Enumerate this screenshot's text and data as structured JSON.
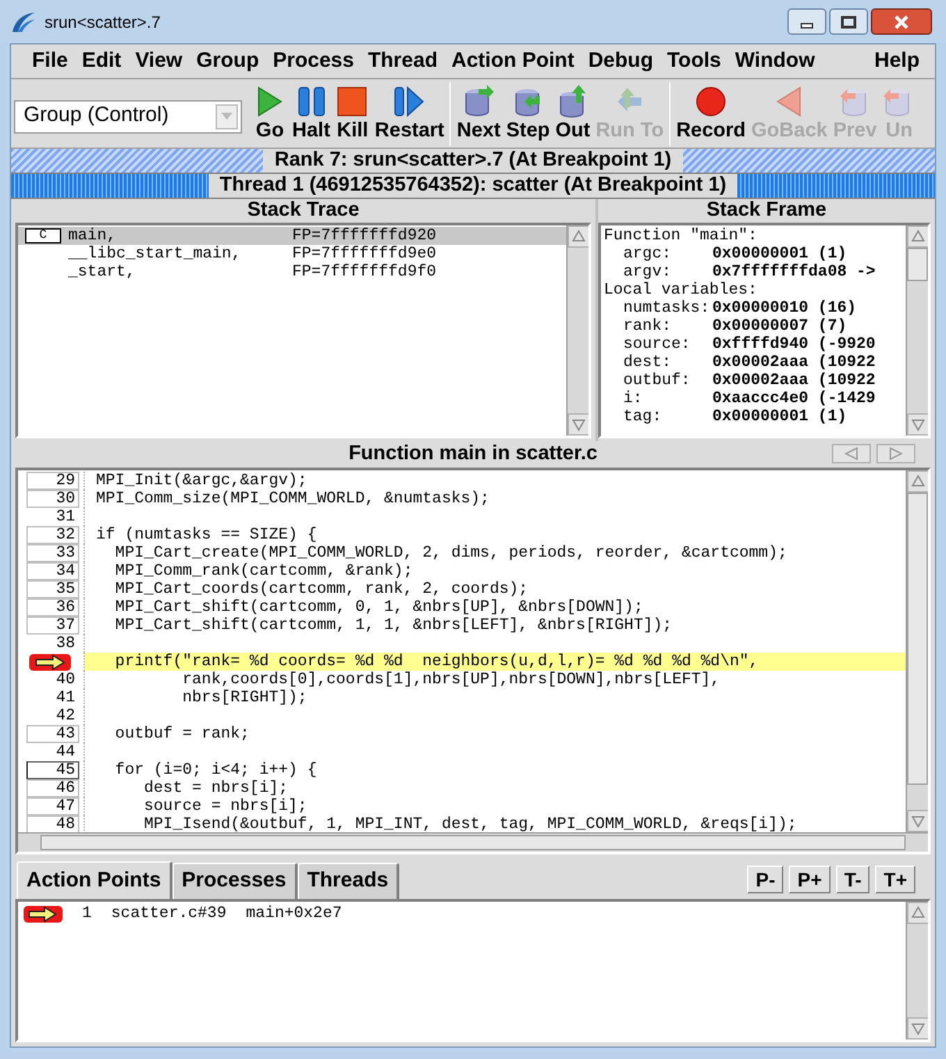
{
  "window": {
    "title": "srun<scatter>.7"
  },
  "menu": [
    {
      "label": "File"
    },
    {
      "label": "Edit"
    },
    {
      "label": "View"
    },
    {
      "label": "Group"
    },
    {
      "label": "Process"
    },
    {
      "label": "Thread"
    },
    {
      "label": "Action Point"
    },
    {
      "label": "Debug"
    },
    {
      "label": "Tools"
    },
    {
      "label": "Window"
    },
    {
      "label": "Help"
    }
  ],
  "toolbar": {
    "group_selector": "Group (Control)",
    "buttons": [
      {
        "kind": "go",
        "label": "Go",
        "disabled": false
      },
      {
        "kind": "halt",
        "label": "Halt",
        "disabled": false
      },
      {
        "kind": "kill",
        "label": "Kill",
        "disabled": false
      },
      {
        "kind": "restart",
        "label": "Restart",
        "disabled": false
      },
      {
        "kind": "next",
        "label": "Next",
        "disabled": false
      },
      {
        "kind": "step",
        "label": "Step",
        "disabled": false
      },
      {
        "kind": "out",
        "label": "Out",
        "disabled": false
      },
      {
        "kind": "runto",
        "label": "Run To",
        "disabled": true
      },
      {
        "kind": "record",
        "label": "Record",
        "disabled": false
      },
      {
        "kind": "goback",
        "label": "GoBack",
        "disabled": true
      },
      {
        "kind": "prev",
        "label": "Prev",
        "disabled": true
      },
      {
        "kind": "prev",
        "label": "Un",
        "disabled": true
      }
    ]
  },
  "rank_bar": "Rank 7: srun<scatter>.7 (At Breakpoint 1)",
  "thread_bar": "Thread 1 (46912535764352): scatter (At Breakpoint 1)",
  "stack_trace": {
    "title": "Stack Trace",
    "frames": [
      {
        "lang": "C",
        "name": "main,",
        "fp": "FP=7fffffffd920",
        "selected": true
      },
      {
        "name": "__libc_start_main,",
        "fp": "FP=7fffffffd9e0",
        "selected": false
      },
      {
        "name": "_start,",
        "fp": "FP=7fffffffd9f0",
        "selected": false
      }
    ]
  },
  "stack_frame": {
    "title": "Stack Frame",
    "rows": [
      {
        "kind": "heading",
        "text": "Function \"main\":"
      },
      {
        "kind": "var",
        "name": "argc:",
        "value": "0x00000001 (1)"
      },
      {
        "kind": "var",
        "name": "argv:",
        "value": "0x7fffffffda08 ->"
      },
      {
        "kind": "heading",
        "text": "Local variables:"
      },
      {
        "kind": "var",
        "name": "numtasks:",
        "value": "0x00000010 (16)"
      },
      {
        "kind": "var",
        "name": "rank:",
        "value": "0x00000007 (7)"
      },
      {
        "kind": "var",
        "name": "source:",
        "value": "0xffffd940 (-9920"
      },
      {
        "kind": "var",
        "name": "dest:",
        "value": "0x00002aaa (10922"
      },
      {
        "kind": "var",
        "name": "outbuf:",
        "value": "0x00002aaa (10922"
      },
      {
        "kind": "var",
        "name": "i:",
        "value": "0xaaccc4e0 (-1429"
      },
      {
        "kind": "var",
        "name": "tag:",
        "value": "0x00000001 (1)"
      }
    ]
  },
  "source": {
    "title": "Function main in scatter.c",
    "lines": [
      {
        "number": "29",
        "boxed": true,
        "text": "MPI_Init(&argc,&argv);"
      },
      {
        "number": "30",
        "boxed": true,
        "text": "MPI_Comm_size(MPI_COMM_WORLD, &numtasks);"
      },
      {
        "number": "31",
        "boxed": false
      },
      {
        "number": "32",
        "boxed": true,
        "text": "if (numtasks == SIZE) {"
      },
      {
        "number": "33",
        "boxed": true,
        "text": "  MPI_Cart_create(MPI_COMM_WORLD, 2, dims, periods, reorder, &cartcomm);"
      },
      {
        "number": "34",
        "boxed": true,
        "text": "  MPI_Comm_rank(cartcomm, &rank);"
      },
      {
        "number": "35",
        "boxed": true,
        "text": "  MPI_Cart_coords(cartcomm, rank, 2, coords);"
      },
      {
        "number": "36",
        "boxed": true,
        "text": "  MPI_Cart_shift(cartcomm, 0, 1, &nbrs[UP], &nbrs[DOWN]);"
      },
      {
        "number": "37",
        "boxed": true,
        "text": "  MPI_Cart_shift(cartcomm, 1, 1, &nbrs[LEFT], &nbrs[RIGHT]);"
      },
      {
        "number": "38",
        "boxed": false
      },
      {
        "action_point": true,
        "current": true,
        "text": "  printf(\"rank= %d coords= %d %d  neighbors(u,d,l,r)= %d %d %d %d\\n\","
      },
      {
        "number": "40",
        "boxed": false,
        "text": "         rank,coords[0],coords[1],nbrs[UP],nbrs[DOWN],nbrs[LEFT],"
      },
      {
        "number": "41",
        "boxed": false,
        "text": "         nbrs[RIGHT]);"
      },
      {
        "number": "42",
        "boxed": false
      },
      {
        "number": "43",
        "boxed": true,
        "text": "  outbuf = rank;"
      },
      {
        "number": "44",
        "boxed": false
      },
      {
        "number": "45",
        "boxed": true,
        "focused": true,
        "text": "  for (i=0; i<4; i++) {"
      },
      {
        "number": "46",
        "boxed": true,
        "text": "     dest = nbrs[i];"
      },
      {
        "number": "47",
        "boxed": true,
        "text": "     source = nbrs[i];"
      },
      {
        "number": "48",
        "boxed": true,
        "text": "     MPI_Isend(&outbuf, 1, MPI_INT, dest, tag, MPI_COMM_WORLD, &reqs[i]);"
      }
    ]
  },
  "bottom_tabs": [
    {
      "label": "Action Points",
      "selected": true
    },
    {
      "label": "Processes",
      "selected": false
    },
    {
      "label": "Threads",
      "selected": false
    }
  ],
  "bottom_buttons": [
    "P-",
    "P+",
    "T-",
    "T+"
  ],
  "action_points": [
    {
      "number": "1",
      "location": "scatter.c#39",
      "address": "main+0x2e7"
    }
  ]
}
